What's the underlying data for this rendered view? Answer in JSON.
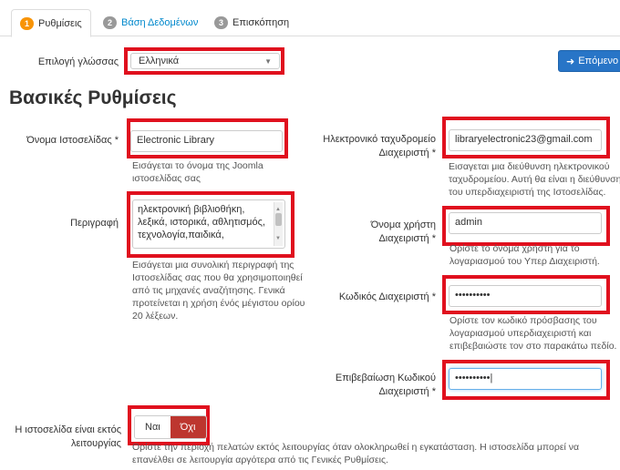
{
  "tabs": [
    {
      "number": "1",
      "label": "Ρυθμίσεις"
    },
    {
      "number": "2",
      "label": "Βάση Δεδομένων"
    },
    {
      "number": "3",
      "label": "Επισκόπηση"
    }
  ],
  "language": {
    "label": "Επιλογή γλώσσας",
    "value": "Ελληνικά"
  },
  "next_button": {
    "label": "Επόμενο",
    "icon": "arrow-right-icon"
  },
  "section_title": "Βασικές Ρυθμίσεις",
  "site_name": {
    "label": "Όνομα Ιστοσελίδας *",
    "value": "Electronic Library",
    "help": [
      "Εισάγεται το όνομα της Joomla",
      "ιστοσελίδας σας"
    ]
  },
  "description": {
    "label": "Περιγραφή",
    "lines": [
      "ηλεκτρονική βιβλιοθήκη,",
      "λεξικά, ιστορικά, αθλητισμός,",
      "τεχνολογία,παιδικά,"
    ],
    "help": [
      "Εισάγεται μια συνολική περιγραφή της",
      "Ιστοσελίδας σας που θα χρησιμοποιηθεί",
      "από τις μηχανές αναζήτησης. Γενικά",
      "προτείνεται η χρήση ένός μέγιστου ορίου",
      "20 λέξεων."
    ]
  },
  "admin_email": {
    "label": [
      "Ηλεκτρονικό ταχυδρομείο",
      "Διαχειριστή *"
    ],
    "value": "libraryelectronic23@gmail.com",
    "help": [
      "Εισαγεται μια διεύθυνση ηλεκτρονικού",
      "ταχυδρομείου. Αυτή θα είναι η διεύθυνση",
      "του υπερδιαχειριστή της Ιστοσελίδας."
    ]
  },
  "admin_username": {
    "label": [
      "Όνομα χρήστη",
      "Διαχειριστή *"
    ],
    "value": "admin",
    "help": [
      "Ορίστε το όνομα χρήστη για το",
      "λογαριασμού του Υπερ Διαχειριστή."
    ]
  },
  "admin_password": {
    "label": "Κωδικός Διαχειριστή *",
    "value": "••••••••••",
    "help": [
      "Ορίστε τον κωδικό πρόσβασης του",
      "λογαριασμού υπερδιαχειριστή και",
      "επιβεβαιώστε τον στο παρακάτω πεδίο."
    ]
  },
  "confirm_password": {
    "label": [
      "Επιβεβαίωση Κωδικού",
      "Διαχειριστή *"
    ],
    "value": "••••••••••"
  },
  "offline": {
    "label": [
      "Η ιστοσελίδα είναι εκτός",
      "λειτουργίας"
    ],
    "yes": "Ναι",
    "no": "Όχι",
    "help": [
      "Ορίστε την περιοχή πελατών εκτός λειτουργίας όταν ολοκληρωθεί η εγκατάσταση. Η ιστοσελίδα μπορεί να",
      "επανέλθει σε λειτουργία αργότερα από τις Γενικές Ρυθμίσεις."
    ]
  },
  "colors": {
    "accent": "#2875c7",
    "highlight": "#e0101e",
    "toggle_on": "#bd362f",
    "badge_active": "#f89406",
    "badge_inactive": "#999999"
  }
}
